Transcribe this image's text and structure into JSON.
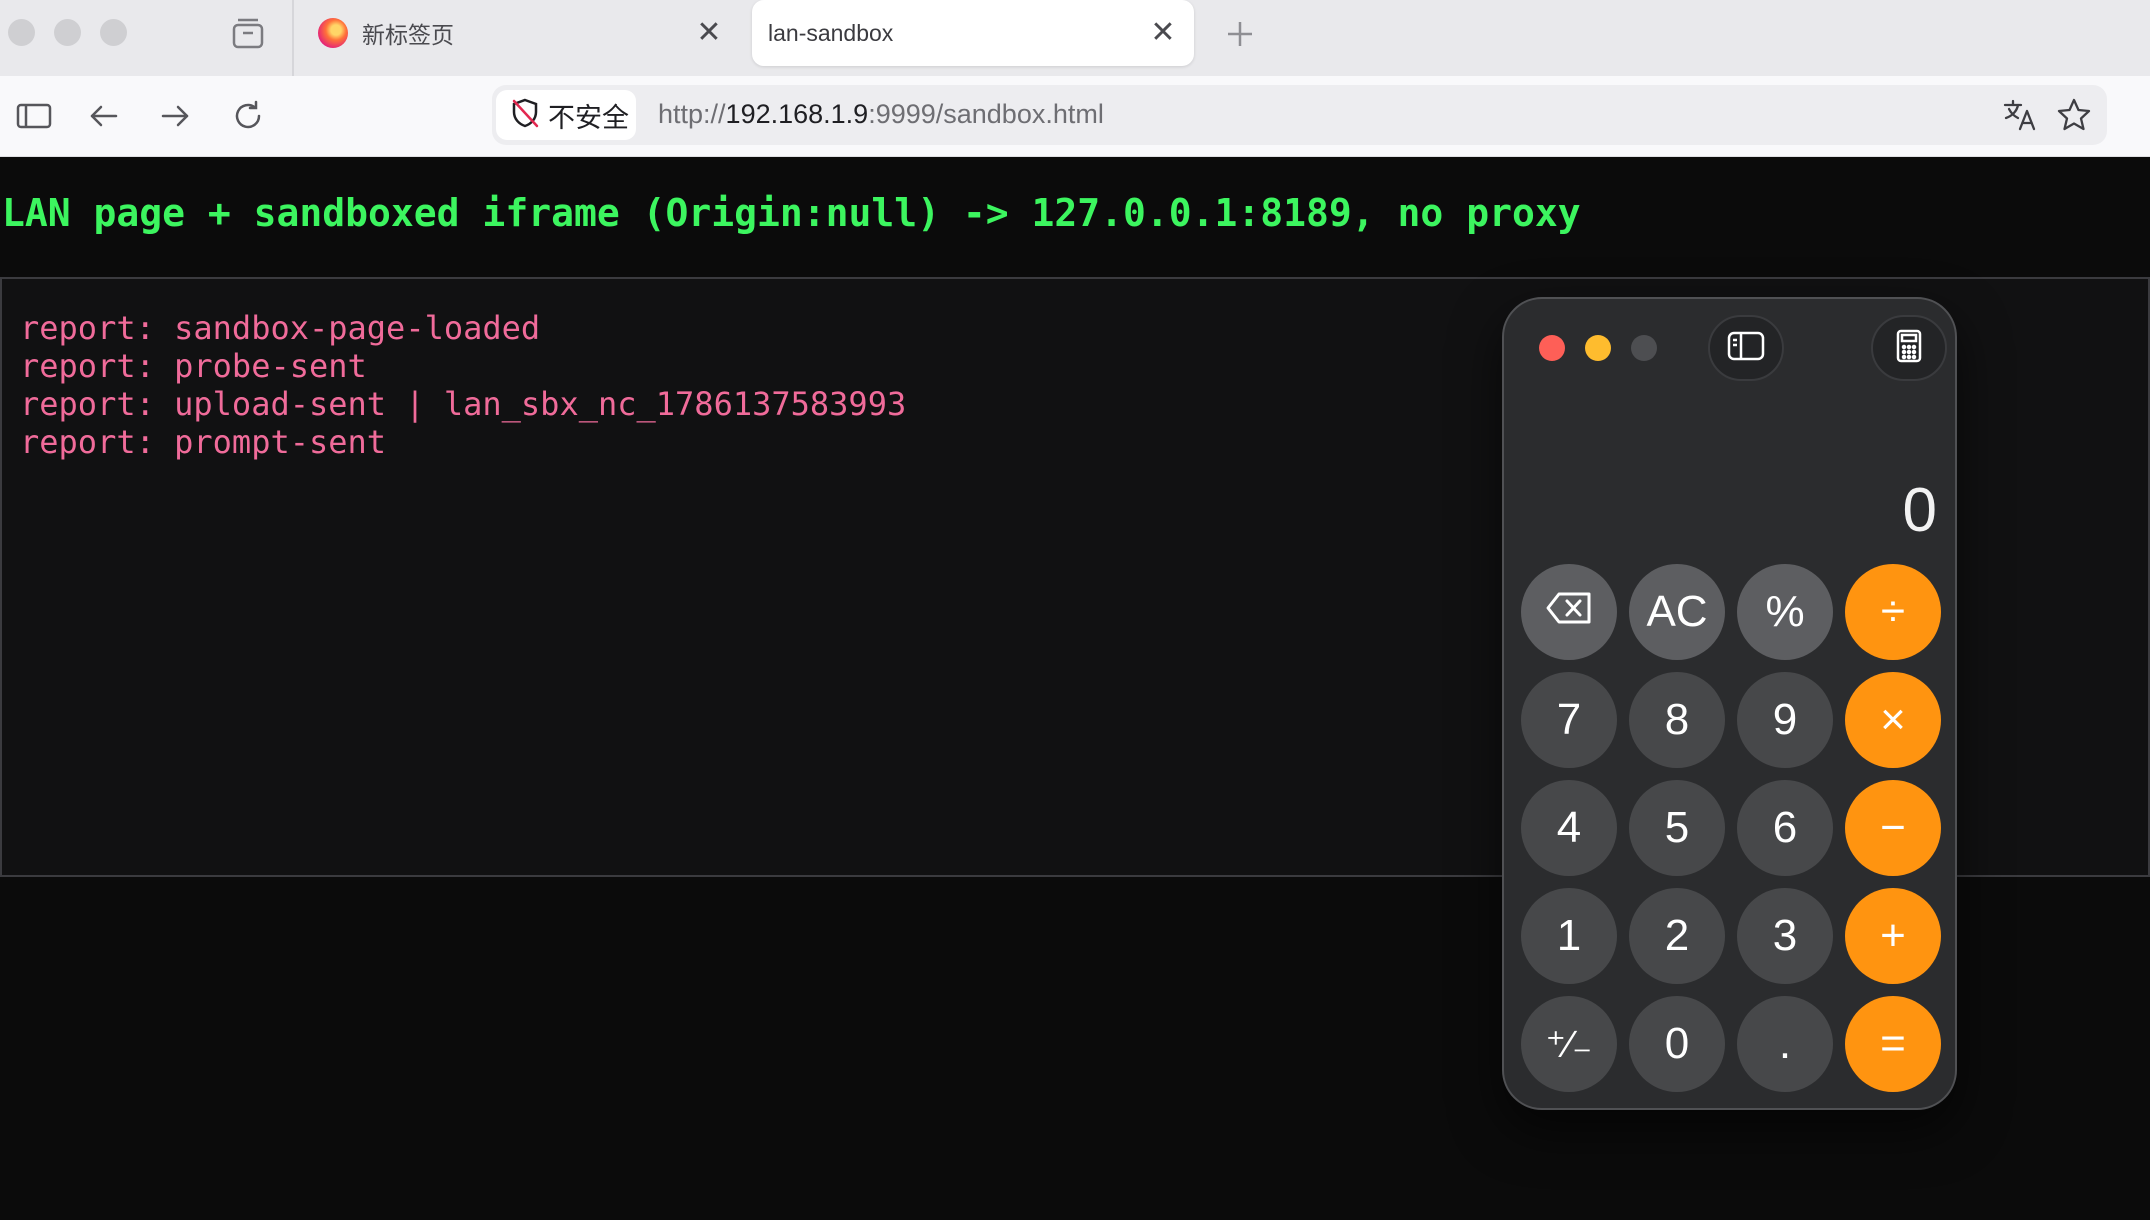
{
  "browser": {
    "tabs": [
      {
        "title": "新标签页",
        "active": false,
        "favicon": "firefox-icon"
      },
      {
        "title": "lan-sandbox",
        "active": true
      }
    ],
    "security_label": "不安全",
    "url": {
      "scheme": "http://",
      "host": "192.168.1.9",
      "rest": ":9999/sandbox.html"
    }
  },
  "page": {
    "title": "LAN page + sandboxed iframe (Origin:null) -> 127.0.0.1:8189, no proxy",
    "log_lines": [
      "report: sandbox-page-loaded",
      "report: probe-sent",
      "report: upload-sent | lan_sbx_nc_1786137583993",
      "report: prompt-sent"
    ],
    "colors": {
      "title": "#3cf55f",
      "log": "#f06b9a",
      "background": "#0b0b0b"
    }
  },
  "calculator": {
    "display": "0",
    "keys": {
      "backspace": "⌫",
      "clear": "AC",
      "percent": "%",
      "divide": "÷",
      "seven": "7",
      "eight": "8",
      "nine": "9",
      "multiply": "×",
      "four": "4",
      "five": "5",
      "six": "6",
      "minus": "−",
      "one": "1",
      "two": "2",
      "three": "3",
      "plus": "+",
      "sign": "⁺∕₋",
      "zero": "0",
      "decimal": ".",
      "equals": "="
    },
    "colors": {
      "operator": "#ff9410",
      "function": "#5d5e61",
      "digit": "#47484a"
    }
  }
}
